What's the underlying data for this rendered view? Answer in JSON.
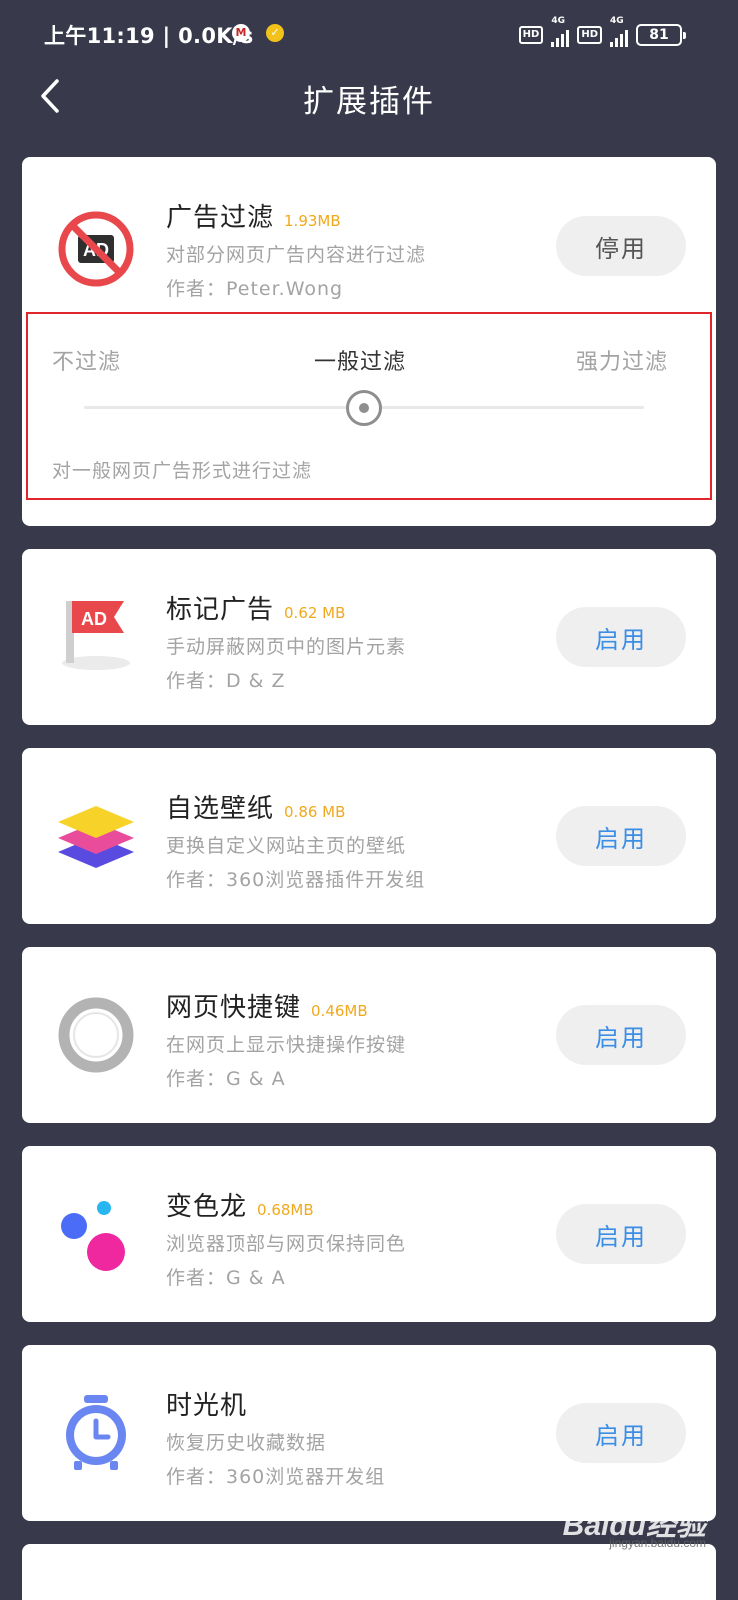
{
  "status_bar": {
    "time": "上午11:19 | 0.0K/s",
    "hd1": "HD",
    "net1": "4G",
    "hd2": "HD",
    "net2": "4G",
    "battery": "81"
  },
  "header": {
    "title": "扩展插件",
    "back_icon": "chevron-left-icon"
  },
  "plugins": [
    {
      "name": "广告过滤",
      "size": "1.93MB",
      "desc": "对部分网页广告内容进行过滤",
      "author": "作者：Peter.Wong",
      "button": "停用",
      "icon": "ad-block-icon"
    },
    {
      "name": "标记广告",
      "size": "0.62 MB",
      "desc": "手动屏蔽网页中的图片元素",
      "author": "作者：D & Z",
      "button": "启用",
      "icon": "ad-flag-icon"
    },
    {
      "name": "自选壁纸",
      "size": "0.86 MB",
      "desc": "更换自定义网站主页的壁纸",
      "author": "作者：360浏览器插件开发组",
      "button": "启用",
      "icon": "layers-icon"
    },
    {
      "name": "网页快捷键",
      "size": "0.46MB",
      "desc": "在网页上显示快捷操作按键",
      "author": "作者：G & A",
      "button": "启用",
      "icon": "ring-icon"
    },
    {
      "name": "变色龙",
      "size": "0.68MB",
      "desc": "浏览器顶部与网页保持同色",
      "author": "作者：G & A",
      "button": "启用",
      "icon": "color-dots-icon"
    },
    {
      "name": "时光机",
      "size": "",
      "desc": "恢复历史收藏数据",
      "author": "作者：360浏览器开发组",
      "button": "启用",
      "icon": "alarm-clock-icon"
    }
  ],
  "filter": {
    "options": [
      "不过滤",
      "一般过滤",
      "强力过滤"
    ],
    "selected": "一般过滤",
    "level": 0.5,
    "description": "对一般网页广告形式进行过滤"
  },
  "watermark": {
    "logo": "Baidu经验",
    "sub": "jingyan.baidu.com"
  },
  "colors": {
    "background": "#383a4b",
    "size_text": "#f2a81c",
    "enable_text": "#3a8ee6",
    "highlight_border": "#e0262a"
  }
}
